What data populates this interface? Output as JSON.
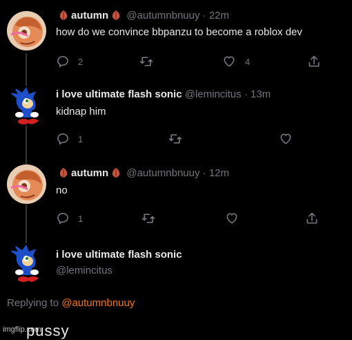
{
  "tweets": [
    {
      "name": "autumn",
      "leaf_emoji": true,
      "handle": "@autumnbnuuy",
      "separator": "·",
      "time": "22m",
      "text": "how do we convince bbpanzu to become a roblox dev",
      "reply_count": "2",
      "retweet_count": "",
      "like_count": "4",
      "avatar": "orange-character-avatar"
    },
    {
      "name": "i love ultimate flash sonic",
      "handle": "@lemincitus",
      "separator": "·",
      "time": "13m",
      "text": "kidnap him",
      "reply_count": "1",
      "retweet_count": "",
      "like_count": "",
      "avatar": "sonic-avatar"
    },
    {
      "name": "autumn",
      "leaf_emoji": true,
      "handle": "@autumnbnuuy",
      "separator": "·",
      "time": "12m",
      "text": "no",
      "reply_count": "1",
      "retweet_count": "",
      "like_count": "",
      "avatar": "orange-character-avatar"
    }
  ],
  "composer": {
    "name": "i love ultimate flash sonic",
    "handle": "@lemincitus",
    "replying_prefix": "Replying to",
    "replying_to": "@autumnbnuuy",
    "draft_text": "pussy",
    "avatar": "sonic-avatar"
  },
  "watermark": "imgflip.com",
  "colors": {
    "background": "#000000",
    "primary_text": "#e7e9ea",
    "secondary_text": "#71767b",
    "mention": "#f97616",
    "thread_line": "#333639"
  }
}
